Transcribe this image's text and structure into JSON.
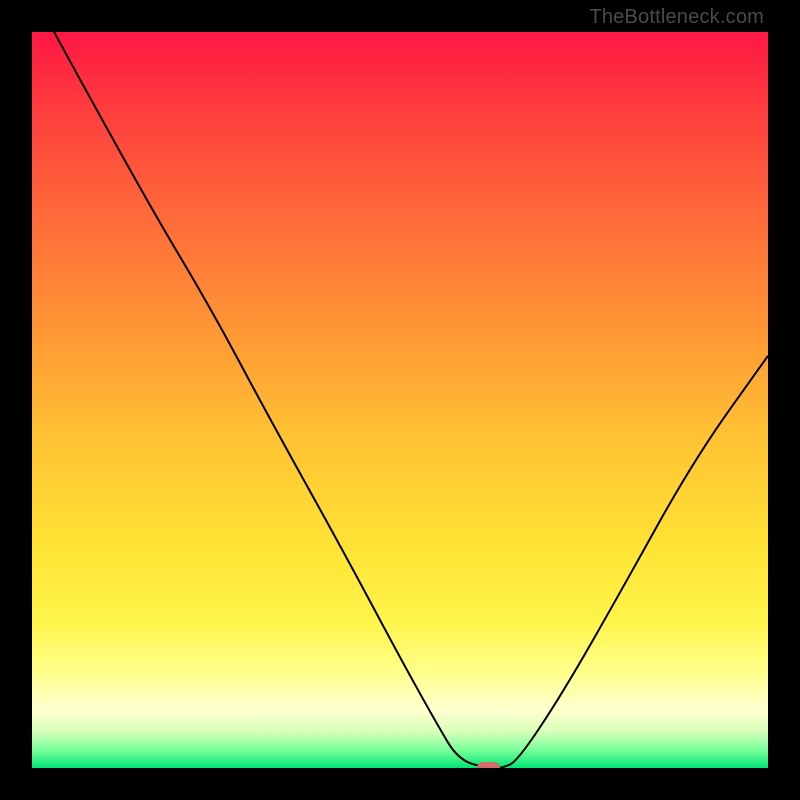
{
  "watermark": "TheBottleneck.com",
  "chart_data": {
    "type": "line",
    "title": "",
    "xlabel": "",
    "ylabel": "",
    "xlim": [
      0,
      100
    ],
    "ylim": [
      0,
      100
    ],
    "background_gradient": {
      "direction": "vertical",
      "stops": [
        {
          "pos": 0.0,
          "color": "#ff1744"
        },
        {
          "pos": 0.1,
          "color": "#ff3b3e"
        },
        {
          "pos": 0.25,
          "color": "#ff6a3a"
        },
        {
          "pos": 0.4,
          "color": "#ff9535"
        },
        {
          "pos": 0.55,
          "color": "#ffc233"
        },
        {
          "pos": 0.7,
          "color": "#ffe334"
        },
        {
          "pos": 0.8,
          "color": "#fff44a"
        },
        {
          "pos": 0.87,
          "color": "#ffff8a"
        },
        {
          "pos": 0.92,
          "color": "#ffffd0"
        },
        {
          "pos": 0.95,
          "color": "#d9ffba"
        },
        {
          "pos": 0.975,
          "color": "#7aff9a"
        },
        {
          "pos": 1.0,
          "color": "#00e676"
        }
      ]
    },
    "series": [
      {
        "name": "bottleneck-curve",
        "stroke": "#000000",
        "stroke_width": 2,
        "points": [
          {
            "x": 3,
            "y": 100
          },
          {
            "x": 15,
            "y": 78
          },
          {
            "x": 24,
            "y": 63
          },
          {
            "x": 32,
            "y": 48
          },
          {
            "x": 42,
            "y": 30
          },
          {
            "x": 50,
            "y": 15
          },
          {
            "x": 55,
            "y": 6
          },
          {
            "x": 58,
            "y": 1
          },
          {
            "x": 62,
            "y": 0
          },
          {
            "x": 64,
            "y": 0
          },
          {
            "x": 66,
            "y": 1
          },
          {
            "x": 72,
            "y": 10
          },
          {
            "x": 80,
            "y": 24
          },
          {
            "x": 90,
            "y": 42
          },
          {
            "x": 100,
            "y": 56
          }
        ]
      }
    ],
    "marker": {
      "name": "optimal-point",
      "x": 62,
      "y": 0,
      "width_pct": 3.2,
      "height_pct": 1.6,
      "color": "#d46a6a"
    }
  }
}
